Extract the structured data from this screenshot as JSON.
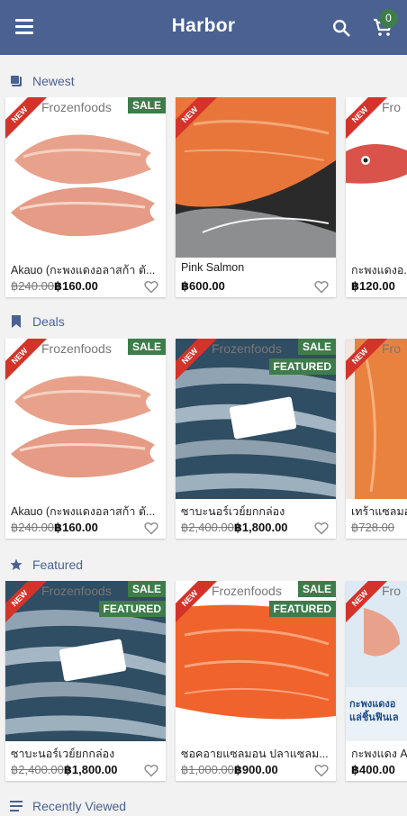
{
  "app": {
    "title": "Harbor",
    "cart_count": "0"
  },
  "sections": [
    {
      "title": "Newest",
      "icon": "stack-icon",
      "products": [
        {
          "name": "Akauo (กะพงแดงอลาสก้า ตั...",
          "brand": "Frozenfoods",
          "sale": "SALE",
          "featured": "",
          "old_price": "฿240.00",
          "price": "฿160.00",
          "image": "red-fish-fillet",
          "ribbon": "NEW"
        },
        {
          "name": "Pink Salmon",
          "brand": "",
          "sale": "",
          "featured": "",
          "old_price": "",
          "price": "฿600.00",
          "image": "salmon-fillet",
          "ribbon": "NEW"
        },
        {
          "name": "กะพงแดงอ...",
          "brand": "Fro",
          "sale": "",
          "featured": "",
          "old_price": "",
          "price": "฿120.00",
          "image": "red-fish-whole",
          "ribbon": "NEW"
        }
      ]
    },
    {
      "title": "Deals",
      "icon": "bookmark-icon",
      "products": [
        {
          "name": "Akauo (กะพงแดงอลาสก้า ตั...",
          "brand": "Frozenfoods",
          "sale": "SALE",
          "featured": "",
          "old_price": "฿240.00",
          "price": "฿160.00",
          "image": "red-fish-fillet",
          "ribbon": "NEW"
        },
        {
          "name": "ซาบะนอร์เวย์ยกกล่อง",
          "brand": "Frozenfoods",
          "sale": "SALE",
          "featured": "FEATURED",
          "old_price": "฿2,400.00",
          "price": "฿1,800.00",
          "image": "mackerel-box",
          "ribbon": "NEW"
        },
        {
          "name": "เทร้าแซลมอ...",
          "brand": "Fro",
          "sale": "",
          "featured": "",
          "old_price": "฿728.00",
          "price": "",
          "image": "trout-fillet",
          "ribbon": "NEW"
        }
      ]
    },
    {
      "title": "Featured",
      "icon": "star-icon",
      "products": [
        {
          "name": "ซาบะนอร์เวย์ยกกล่อง",
          "brand": "Frozenfoods",
          "sale": "SALE",
          "featured": "FEATURED",
          "old_price": "฿2,400.00",
          "price": "฿1,800.00",
          "image": "mackerel-box",
          "ribbon": "NEW"
        },
        {
          "name": "ซอคอายแซลมอน ปลาแซลม...",
          "brand": "Frozenfoods",
          "sale": "SALE",
          "featured": "FEATURED",
          "old_price": "฿1,000.00",
          "price": "฿900.00",
          "image": "sockeye-fillet",
          "ribbon": "NEW"
        },
        {
          "name": "กะพงแดง A...",
          "brand": "Fro",
          "sale": "",
          "featured": "",
          "old_price": "",
          "price": "฿400.00",
          "image": "packaged-fish",
          "ribbon": "NEW",
          "pack_text": "กะพงแดงอ แล่ชิ้นฟินเล"
        }
      ]
    },
    {
      "title": "Recently Viewed",
      "icon": "list-icon",
      "products": []
    }
  ]
}
